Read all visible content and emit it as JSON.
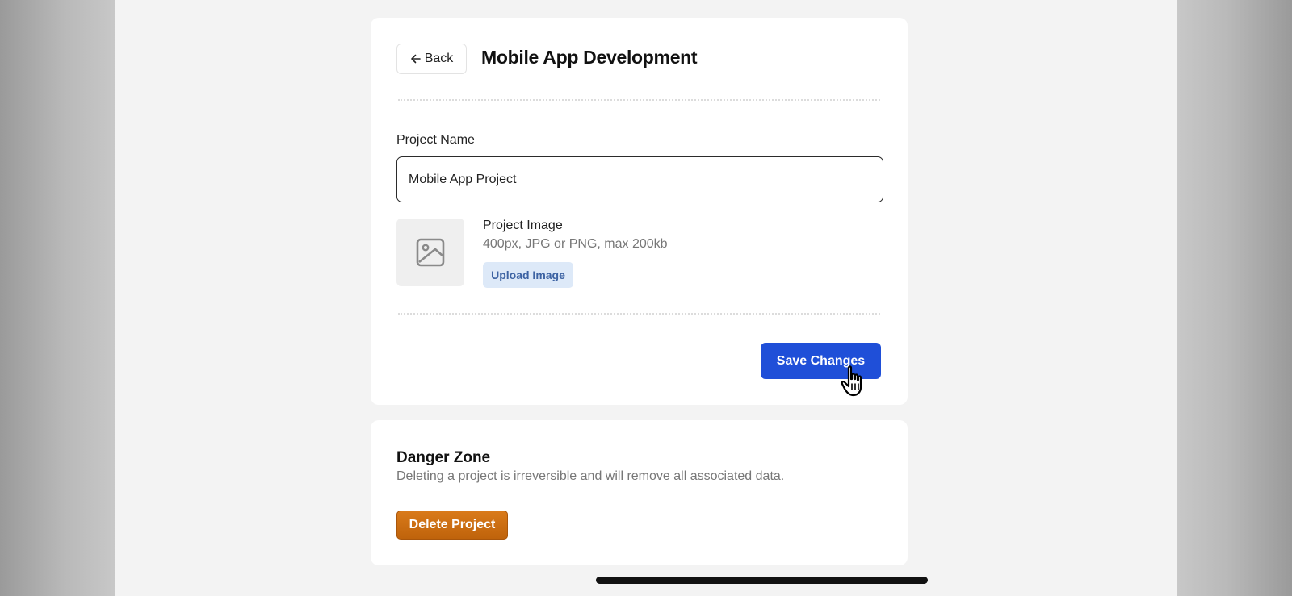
{
  "header": {
    "back_label": "Back",
    "title": "Mobile App Development"
  },
  "form": {
    "project_name_label": "Project Name",
    "project_name_value": "Mobile App Project",
    "image_title": "Project Image",
    "image_hint": "400px, JPG or PNG, max 200kb",
    "upload_label": "Upload Image",
    "save_label": "Save Changes"
  },
  "danger": {
    "title": "Danger Zone",
    "description": "Deleting a project is irreversible and will remove all associated data.",
    "delete_label": "Delete Project"
  },
  "colors": {
    "primary": "#1f4fd8",
    "danger": "#c96b10",
    "upload_bg": "#dde9f8"
  },
  "icons": {
    "back": "arrow-left-icon",
    "image": "image-placeholder-icon",
    "cursor": "hand-pointer-icon"
  }
}
